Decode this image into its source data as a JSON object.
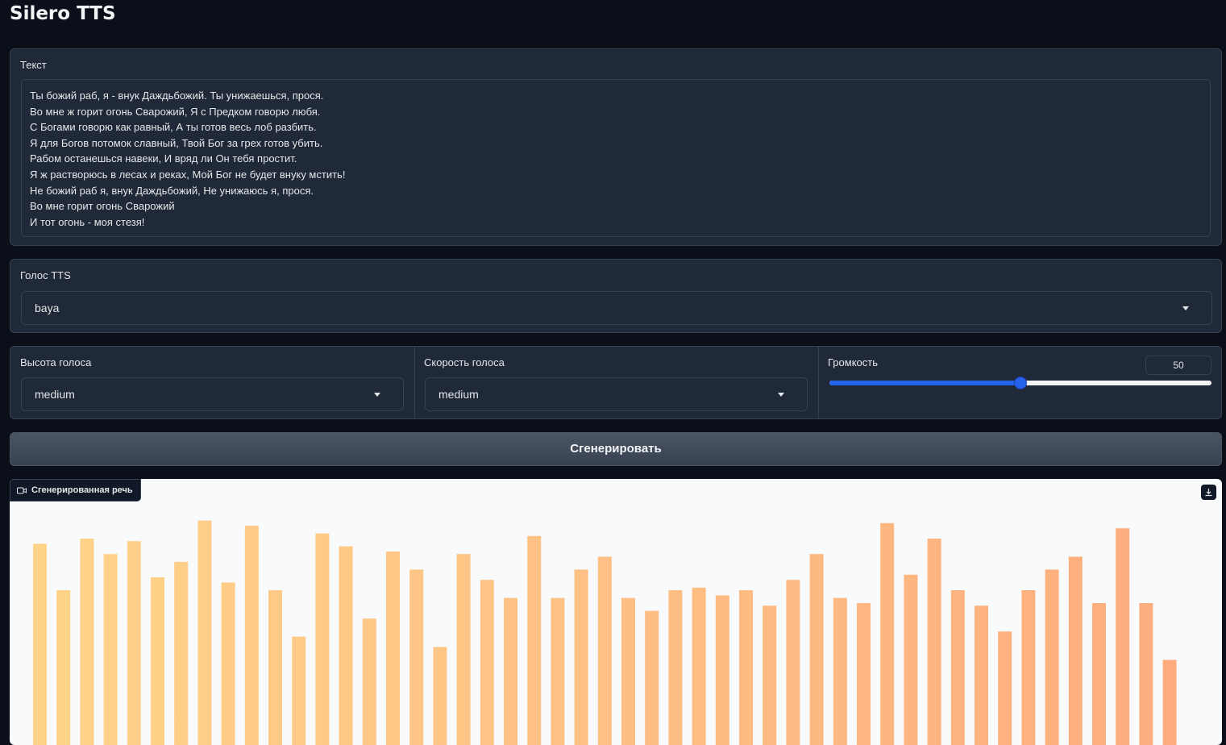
{
  "app": {
    "title": "Silero TTS"
  },
  "text_input": {
    "label": "Текст",
    "lines": [
      "Ты божий раб, я - внук Даждьбожий. Ты унижаешься, прося.",
      "Во мне ж горит огонь Сварожий, Я с Предком говорю любя.",
      "С Богами говорю как равный, А ты готов весь лоб разбить.",
      "Я для Богов потомок славный, Твой Бог за грех готов убить.",
      "Рабом останешься навеки, И вряд ли Он тебя простит.",
      "Я ж растворюсь в лесах и реках, Мой Бог не будет внуку мстить!",
      "Не божий раб я, внук Даждьбожий, Не унижаюсь я, прося.",
      "Во мне горит огонь Сварожий",
      "И тот огонь - моя стезя!"
    ]
  },
  "voice": {
    "label": "Голос TTS",
    "value": "baya"
  },
  "pitch": {
    "label": "Высота голоса",
    "value": "medium"
  },
  "rate": {
    "label": "Скорость голоса",
    "value": "medium"
  },
  "volume": {
    "label": "Громкость",
    "value": "50",
    "level": 0.5
  },
  "generate_button": {
    "label": "Сгенерировать"
  },
  "output": {
    "label": "Сгенерированная речь",
    "icon": "video-icon",
    "download_icon": "download-icon",
    "waveform_levels": [
      0.78,
      0.6,
      0.8,
      0.74,
      0.79,
      0.65,
      0.71,
      0.87,
      0.63,
      0.85,
      0.6,
      0.42,
      0.82,
      0.77,
      0.49,
      0.75,
      0.68,
      0.38,
      0.74,
      0.64,
      0.57,
      0.81,
      0.57,
      0.68,
      0.73,
      0.57,
      0.52,
      0.6,
      0.61,
      0.58,
      0.6,
      0.54,
      0.64,
      0.74,
      0.57,
      0.55,
      0.86,
      0.66,
      0.8,
      0.6,
      0.54,
      0.44,
      0.6,
      0.68,
      0.73,
      0.55,
      0.84,
      0.55,
      0.33
    ],
    "waveform_colors": [
      "#ffd48a",
      "#fdab7d"
    ]
  }
}
